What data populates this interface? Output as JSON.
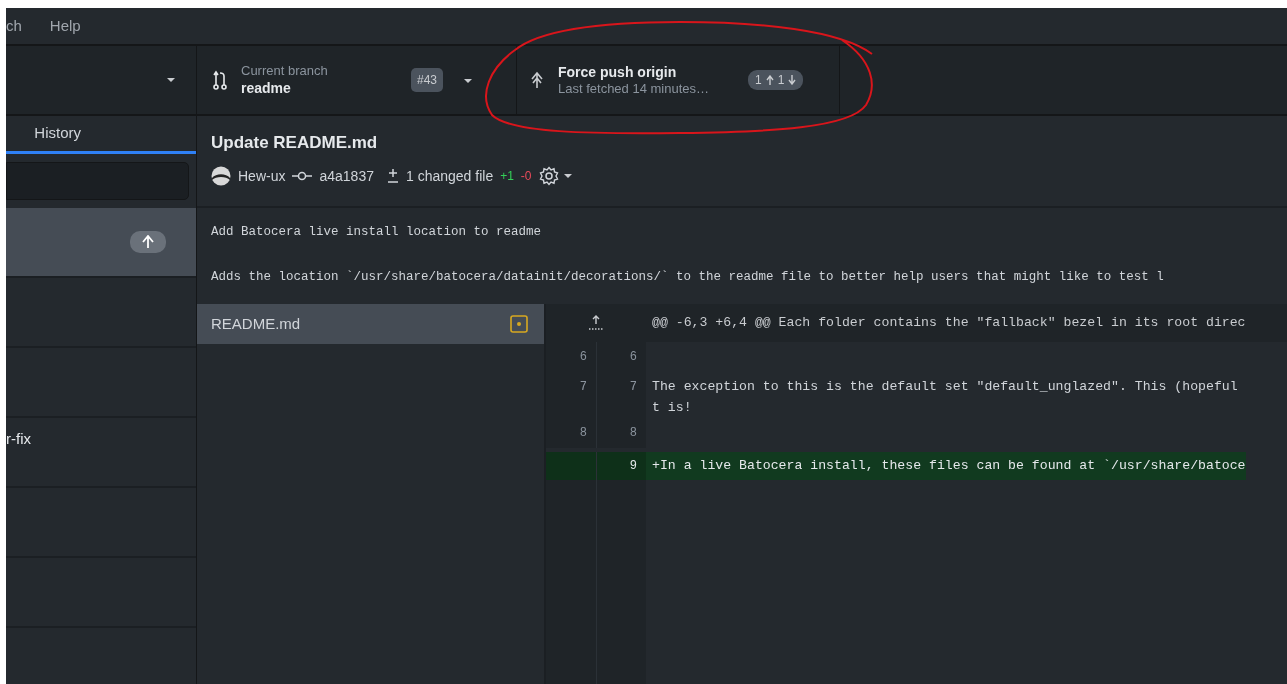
{
  "menu": [
    {
      "label": "ch"
    },
    {
      "label": "Help"
    }
  ],
  "branch": {
    "label": "Current branch",
    "name": "readme",
    "pr": "#43"
  },
  "push": {
    "title": "Force push origin",
    "subtitle": "Last fetched 14 minutes…",
    "ahead": "1",
    "behind": "1"
  },
  "sidebar": {
    "tabs": [
      {
        "label": "History",
        "selected": true
      }
    ],
    "commits": [
      {
        "selected": true,
        "unpushed": true
      },
      {
        "selected": false,
        "unpushed": false
      },
      {
        "selected": false,
        "unpushed": false
      },
      {
        "selected": false,
        "unpushed": false,
        "title": "r-fix"
      },
      {
        "selected": false,
        "unpushed": false
      },
      {
        "selected": false,
        "unpushed": false
      }
    ]
  },
  "commit": {
    "title": "Update README.md",
    "author": "Hew-ux",
    "sha": "a4a1837",
    "changed": "1 changed file",
    "added": "+1",
    "removed": "-0",
    "message": "Add Batocera live install location to readme",
    "body": "Adds the location `/usr/share/batocera/datainit/decorations/` to the readme file to better help users that might like to test l"
  },
  "files": [
    {
      "name": "README.md",
      "kind": "modified",
      "selected": true
    }
  ],
  "diff": {
    "hunk": "@@ -6,3 +6,4 @@ Each folder contains the \"fallback\" bezel in its root direc",
    "lines": [
      {
        "kind": "context",
        "old": "6",
        "new": "6"
      },
      {
        "kind": "context",
        "old": "7",
        "new": "7",
        "text": " The exception to this is the default set \"default_unglazed\". This (hopeful",
        "wrap": "t is!"
      },
      {
        "kind": "context",
        "old": "8",
        "new": "8"
      },
      {
        "kind": "added",
        "new": "9",
        "text": "+In a live Batocera install, these files can be found at `/usr/share/batoce"
      }
    ]
  }
}
